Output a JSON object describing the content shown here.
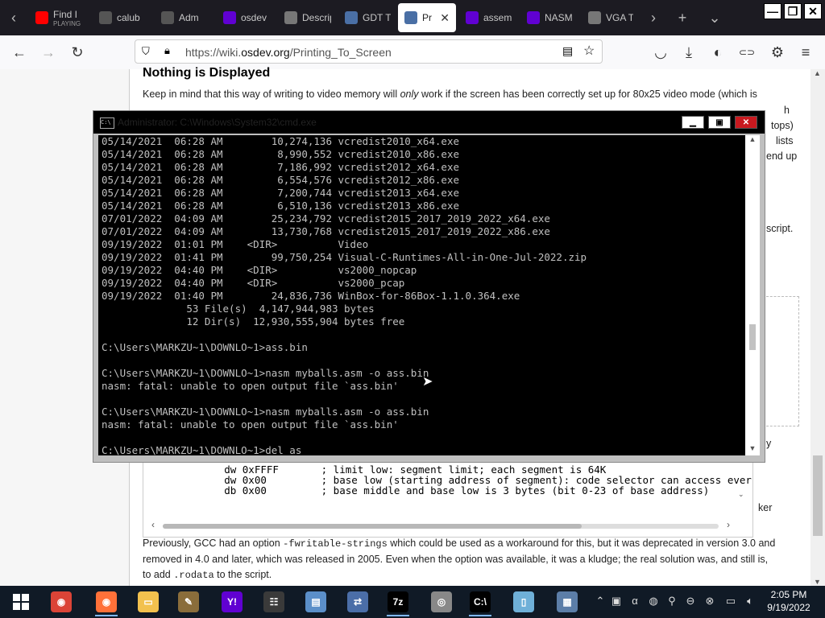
{
  "browser": {
    "tabs": [
      {
        "label": "Find I",
        "sublabel": "PLAYING",
        "icon": "youtube-icon",
        "color": "#ff0000"
      },
      {
        "label": "calub",
        "icon": "code-icon",
        "color": "#555555"
      },
      {
        "label": "Adm",
        "icon": "code-icon",
        "color": "#555555"
      },
      {
        "label": "osdev",
        "icon": "yahoo-icon",
        "color": "#6001d2"
      },
      {
        "label": "Descriptor",
        "icon": "globe-icon",
        "color": "#777777"
      },
      {
        "label": "GDT T",
        "icon": "page-icon",
        "color": "#4a6fa5"
      },
      {
        "label": "Prin",
        "icon": "page-icon",
        "color": "#4a6fa5"
      },
      {
        "label": "assem",
        "icon": "yahoo-icon",
        "color": "#6001d2"
      },
      {
        "label": "NASM",
        "icon": "yahoo-icon",
        "color": "#6001d2"
      },
      {
        "label": "VGA T",
        "icon": "globe-icon",
        "color": "#777777"
      }
    ],
    "url_prefix": "https://wiki.",
    "url_domain": "osdev.org",
    "url_path": "/Printing_To_Screen"
  },
  "article": {
    "heading": "Nothing is Displayed",
    "para1_a": "Keep in mind that this way of writing to video memory will ",
    "para1_em": "only",
    "para1_b": " work if the screen has been correctly set up for 80x25 video mode (which is",
    "frag_h": "h",
    "frag_tops": "tops)",
    "frag_lists": "lists",
    "frag_endup": "end up",
    "frag_script": "script.",
    "frag_y": "y",
    "frag_ker": "ker",
    "code_lines": "        dw 0xFFFF       ; limit low: segment limit; each segment is 64K\n        dw 0x00         ; base low (starting address of segment): code selector can access ever\n        db 0x00         ; base middle and base low is 3 bytes (bit 0-23 of base address)",
    "para2_a": "Previously, GCC had an option ",
    "para2_code": "-fwritable-strings",
    "para2_b": " which could be used as a workaround for this, but it was deprecated in version 3.0 and",
    "para2_line2": "removed in 4.0 and later, which was released in 2005. Even when the option was available, it was a kludge; the real solution was, and still is,",
    "para2_line3_a": "to add ",
    "para2_line3_code": ".rodata",
    "para2_line3_b": " to the script."
  },
  "cmd": {
    "title": "Administrator: C:\\Windows\\System32\\cmd.exe",
    "lines": [
      "05/14/2021  06:28 AM        10,274,136 vcredist2010_x64.exe",
      "05/14/2021  06:28 AM         8,990,552 vcredist2010_x86.exe",
      "05/14/2021  06:28 AM         7,186,992 vcredist2012_x64.exe",
      "05/14/2021  06:28 AM         6,554,576 vcredist2012_x86.exe",
      "05/14/2021  06:28 AM         7,200,744 vcredist2013_x64.exe",
      "05/14/2021  06:28 AM         6,510,136 vcredist2013_x86.exe",
      "07/01/2022  04:09 AM        25,234,792 vcredist2015_2017_2019_2022_x64.exe",
      "07/01/2022  04:09 AM        13,730,768 vcredist2015_2017_2019_2022_x86.exe",
      "09/19/2022  01:01 PM    <DIR>          Video",
      "09/19/2022  01:41 PM        99,750,254 Visual-C-Runtimes-All-in-One-Jul-2022.zip",
      "09/19/2022  04:40 PM    <DIR>          vs2000_nopcap",
      "09/19/2022  04:40 PM    <DIR>          vs2000_pcap",
      "09/19/2022  01:40 PM        24,836,736 WinBox-for-86Box-1.1.0.364.exe",
      "              53 File(s)  4,147,944,983 bytes",
      "              12 Dir(s)  12,930,555,904 bytes free",
      "",
      "C:\\Users\\MARKZU~1\\DOWNLO~1>ass.bin",
      "",
      "C:\\Users\\MARKZU~1\\DOWNLO~1>nasm myballs.asm -o ass.bin",
      "nasm: fatal: unable to open output file `ass.bin'",
      "",
      "C:\\Users\\MARKZU~1\\DOWNLO~1>nasm myballs.asm -o ass.bin",
      "nasm: fatal: unable to open output file `ass.bin'",
      "",
      "C:\\Users\\MARKZU~1\\DOWNLO~1>del as"
    ]
  },
  "taskbar": {
    "time": "2:05 PM",
    "date": "9/19/2022",
    "apps": [
      {
        "name": "chrome-icon",
        "color": "#db4437",
        "glyph": "◉"
      },
      {
        "name": "firefox-icon",
        "color": "#ff7139",
        "glyph": "◉"
      },
      {
        "name": "folder-icon",
        "color": "#f2c14e",
        "glyph": "▭"
      },
      {
        "name": "paint-icon",
        "color": "#8a6d3b",
        "glyph": "✎"
      },
      {
        "name": "yahoo-icon",
        "color": "#6001d2",
        "glyph": "Y!"
      },
      {
        "name": "mixer-icon",
        "color": "#3a3a3a",
        "glyph": "☷"
      },
      {
        "name": "monitor-icon",
        "color": "#5b8fc9",
        "glyph": "▤"
      },
      {
        "name": "network-icon",
        "color": "#4b6ea8",
        "glyph": "⇄"
      },
      {
        "name": "7zip-icon",
        "color": "#000000",
        "glyph": "7z"
      },
      {
        "name": "disc-icon",
        "color": "#888888",
        "glyph": "◎"
      },
      {
        "name": "cmd-icon",
        "color": "#000000",
        "glyph": "C:\\"
      },
      {
        "name": "notepad-icon",
        "color": "#6fb0d8",
        "glyph": "▯"
      },
      {
        "name": "calculator-icon",
        "color": "#5c7ea8",
        "glyph": "▦"
      }
    ]
  }
}
